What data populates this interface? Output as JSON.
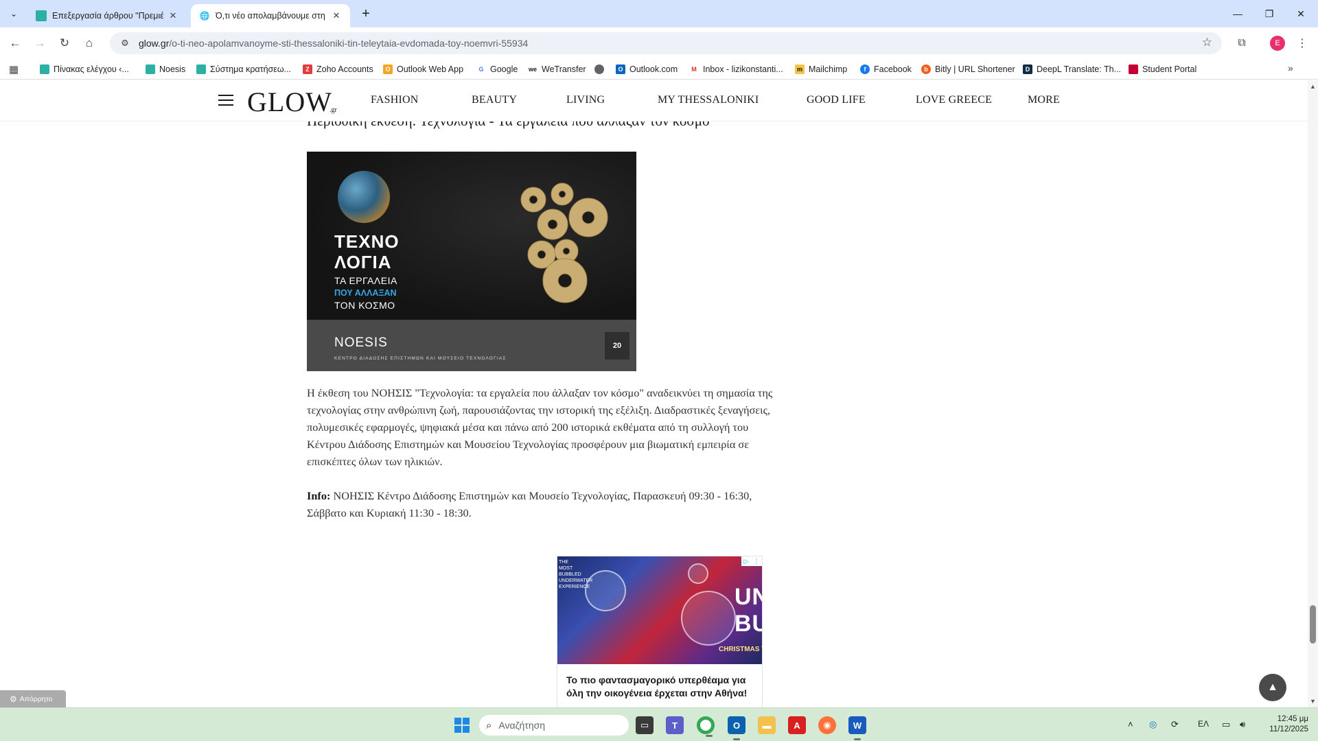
{
  "browser": {
    "tabs": [
      {
        "title": "Επεξεργασία άρθρου \"Πρεμιέρ",
        "active": false
      },
      {
        "title": "Ό,τι νέο απολαμβάνουμε στη Θ",
        "active": true
      }
    ],
    "url_host": "glow.gr",
    "url_path": "/o-ti-neo-apolamvanoyme-sti-thessaloniki-tin-teleytaia-evdomada-toy-noemvri-55934",
    "profile_initial": "E",
    "bookmarks": [
      {
        "label": "Πίνακας ελέγχου ‹...",
        "color": "#2bb0a6"
      },
      {
        "label": "Noesis",
        "color": "#2bb0a6"
      },
      {
        "label": "Σύστημα κρατήσεω...",
        "color": "#2bb0a6"
      },
      {
        "label": "Zoho Accounts",
        "color": "#e23b3b"
      },
      {
        "label": "Outlook Web App",
        "color": "#f5a623"
      },
      {
        "label": "Google",
        "color": "#4285f4"
      },
      {
        "label": "WeTransfer",
        "color": "#1a1a1a"
      },
      {
        "label": "",
        "color": "#5f6368"
      },
      {
        "label": "Outlook.com",
        "color": "#0a66c2"
      },
      {
        "label": "Inbox - lizikonstanti...",
        "color": "#d93025"
      },
      {
        "label": "Mailchimp",
        "color": "#f6c445"
      },
      {
        "label": "Facebook",
        "color": "#1877f2"
      },
      {
        "label": "Bitly | URL Shortener",
        "color": "#ee6123"
      },
      {
        "label": "DeepL Translate: Th...",
        "color": "#0f2b46"
      },
      {
        "label": "Student Portal",
        "color": "#c3002f"
      }
    ]
  },
  "site": {
    "logo": "GLOW",
    "logo_suffix": ".gr",
    "nav": [
      "FASHION",
      "BEAUTY",
      "LIVING",
      "MY THESSALONIKI",
      "GOOD LIFE",
      "LOVE GREECE",
      "MORE"
    ]
  },
  "article": {
    "partial_heading": "Περιοδική έκθεση: Τεχνολογία - Τα εργαλεία που άλλαξαν τον κόσμο",
    "image": {
      "line1": "ΤΕΧΝΟ",
      "line2": "ΛΟΓΙΑ",
      "line3": "ΤΑ ΕΡΓΑΛΕΙΑ",
      "line4": "ΠΟΥ ΑΛΛΑΞΑΝ",
      "line5": "ΤΟΝ ΚΟΣΜΟ",
      "brand": "NOESIS",
      "brand_sub": "ΚΕΝΤΡΟ ΔΙΑΔΟΣΗΣ ΕΠΙΣΤΗΜΩΝ ΚΑΙ ΜΟΥΣΕΙΟ ΤΕΧΝΟΛΟΓΙΑΣ",
      "badge": "20"
    },
    "paragraph": "Η έκθεση του ΝΟΗΣΙΣ \"Τεχνολογία: τα εργαλεία που άλλαξαν τον κόσμο\" αναδεικνύει τη σημασία της τεχνολογίας στην ανθρώπινη ζωή, παρουσιάζοντας την ιστορική της εξέλιξη. Διαδραστικές ξεναγήσεις, πολυμεσικές εφαρμογές, ψηφιακά μέσα και πάνω από 200 ιστορικά εκθέματα από τη συλλογή του Κέντρου Διάδοσης Επιστημών και Μουσείου Τεχνολογίας προσφέρουν μια βιωματική εμπειρία σε επισκέπτες όλων των ηλικιών.",
    "info_label": "Info:",
    "info_text": " ΝΟΗΣΙΣ Κέντρο Διάδοσης Επιστημών και Μουσείο Τεχνολογίας, Παρασκευή 09:30 - 16:30, Σάββατο και Κυριακή 11:30 - 18:30."
  },
  "ad": {
    "side_text": "THE MOST BUBBLED UNDERWATER EXPERIENCE",
    "big_text": "UNI BUB",
    "xmas_text": "CHRISTMAS THEATRE",
    "caption": "Το πιο φαντασμαγορικό υπερθέαμα για όλη την οικογένεια έρχεται στην Αθήνα!"
  },
  "cookie_button": "Απόρρητο",
  "taskbar": {
    "search_placeholder": "Αναζήτηση",
    "language": "ΕΛ",
    "time": "12:45 μμ",
    "date": "11/12/2025"
  }
}
